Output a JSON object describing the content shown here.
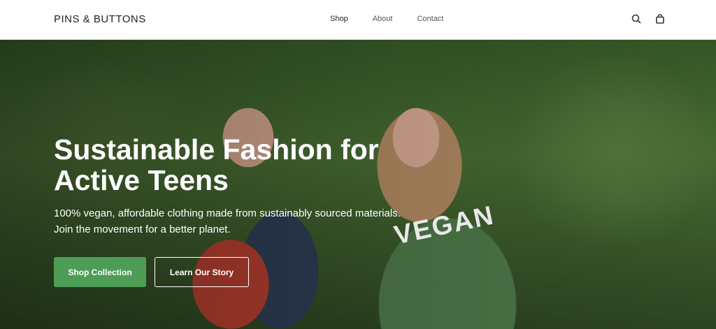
{
  "header": {
    "logo": "PINS & BUTTONS",
    "nav": [
      "Shop",
      "About",
      "Contact"
    ],
    "icons": [
      "search-icon",
      "shopping-bag-icon"
    ]
  },
  "hero": {
    "headline": "Sustainable Fashion for Active Teens",
    "subtitle_line1": "100% vegan, affordable clothing made from sustainably sourced materials.",
    "subtitle_line2": "Join the movement for a better planet.",
    "primary_button": "Shop Collection",
    "secondary_button": "Learn Our Story",
    "shirt_text": "VEGAN"
  },
  "colors": {
    "accent": "#4e9d56"
  }
}
